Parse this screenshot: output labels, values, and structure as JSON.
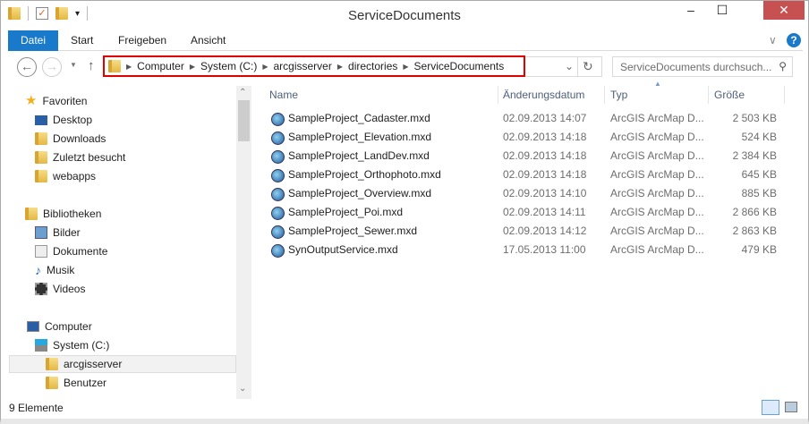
{
  "window": {
    "title": "ServiceDocuments",
    "minimize": "–",
    "maximize": "☐",
    "close": "✕"
  },
  "ribbon": {
    "tabs": [
      "Datei",
      "Start",
      "Freigeben",
      "Ansicht"
    ],
    "help": "?",
    "expand": "∨"
  },
  "address": {
    "crumbs": [
      "Computer",
      "System (C:)",
      "arcgisserver",
      "directories",
      "ServiceDocuments"
    ],
    "highlight_color": "#e00000"
  },
  "search": {
    "placeholder": "ServiceDocuments durchsuch..."
  },
  "nav": {
    "favorites": {
      "label": "Favoriten",
      "items": [
        "Desktop",
        "Downloads",
        "Zuletzt besucht",
        "webapps"
      ]
    },
    "libraries": {
      "label": "Bibliotheken",
      "items": [
        "Bilder",
        "Dokumente",
        "Musik",
        "Videos"
      ]
    },
    "computer": {
      "label": "Computer",
      "drive": "System (C:)",
      "folders": [
        "arcgisserver",
        "Benutzer"
      ],
      "selected": "arcgisserver"
    }
  },
  "columns": {
    "name": "Name",
    "date": "Änderungsdatum",
    "type": "Typ",
    "size": "Größe"
  },
  "files": [
    {
      "name": "SampleProject_Cadaster.mxd",
      "date": "02.09.2013 14:07",
      "type": "ArcGIS ArcMap D...",
      "size": "2 503 KB"
    },
    {
      "name": "SampleProject_Elevation.mxd",
      "date": "02.09.2013 14:18",
      "type": "ArcGIS ArcMap D...",
      "size": "524 KB"
    },
    {
      "name": "SampleProject_LandDev.mxd",
      "date": "02.09.2013 14:18",
      "type": "ArcGIS ArcMap D...",
      "size": "2 384 KB"
    },
    {
      "name": "SampleProject_Orthophoto.mxd",
      "date": "02.09.2013 14:18",
      "type": "ArcGIS ArcMap D...",
      "size": "645 KB"
    },
    {
      "name": "SampleProject_Overview.mxd",
      "date": "02.09.2013 14:10",
      "type": "ArcGIS ArcMap D...",
      "size": "885 KB"
    },
    {
      "name": "SampleProject_Poi.mxd",
      "date": "02.09.2013 14:11",
      "type": "ArcGIS ArcMap D...",
      "size": "2 866 KB"
    },
    {
      "name": "SampleProject_Sewer.mxd",
      "date": "02.09.2013 14:12",
      "type": "ArcGIS ArcMap D...",
      "size": "2 863 KB"
    },
    {
      "name": "SynOutputService.mxd",
      "date": "17.05.2013 11:00",
      "type": "ArcGIS ArcMap D...",
      "size": "479 KB"
    }
  ],
  "status": {
    "count": "9 Elemente"
  }
}
